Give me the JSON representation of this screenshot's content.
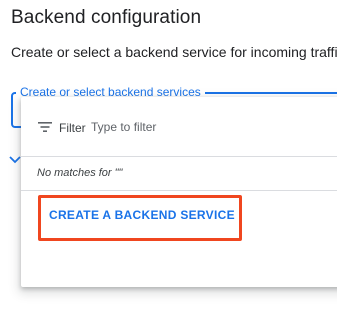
{
  "page": {
    "title": "Backend configuration",
    "subtitle": "Create or select a backend service for incoming traffic. Yo"
  },
  "select": {
    "label": "Create or select backend services"
  },
  "dropdown": {
    "filter_label": "Filter",
    "filter_placeholder": "Type to filter",
    "filter_value": "",
    "no_matches_text": "No matches for \"\"",
    "create_button_label": "CREATE A BACKEND SERVICE"
  },
  "colors": {
    "accent": "#1a73e8",
    "highlight": "#f0461f",
    "divider": "#dadce0"
  },
  "icons": {
    "filter": "filter-lines-icon",
    "chevron": "chevron-down-icon"
  }
}
